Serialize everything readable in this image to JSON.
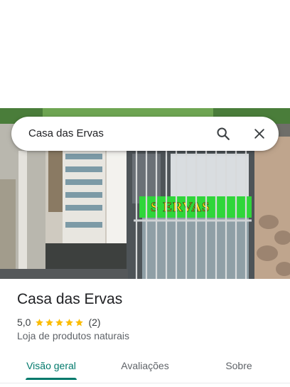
{
  "search": {
    "query": "Casa das Ervas",
    "search_icon": "search-icon",
    "close_icon": "close-icon"
  },
  "photo": {
    "storefront_sign": "S ERVAS",
    "sign_color": "#2fd63a",
    "sign_text_color": "#f2e21b"
  },
  "place": {
    "name": "Casa das Ervas",
    "rating": "5,0",
    "rating_value": 5.0,
    "stars_max": 5,
    "review_count": "(2)",
    "category": "Loja de produtos naturais",
    "star_color": "#fbbc04"
  },
  "tabs": [
    {
      "label": "Visão geral",
      "active": true
    },
    {
      "label": "Avaliações",
      "active": false
    },
    {
      "label": "Sobre",
      "active": false
    }
  ],
  "colors": {
    "accent": "#00796b",
    "text_primary": "#202124",
    "text_secondary": "#5f6368"
  }
}
